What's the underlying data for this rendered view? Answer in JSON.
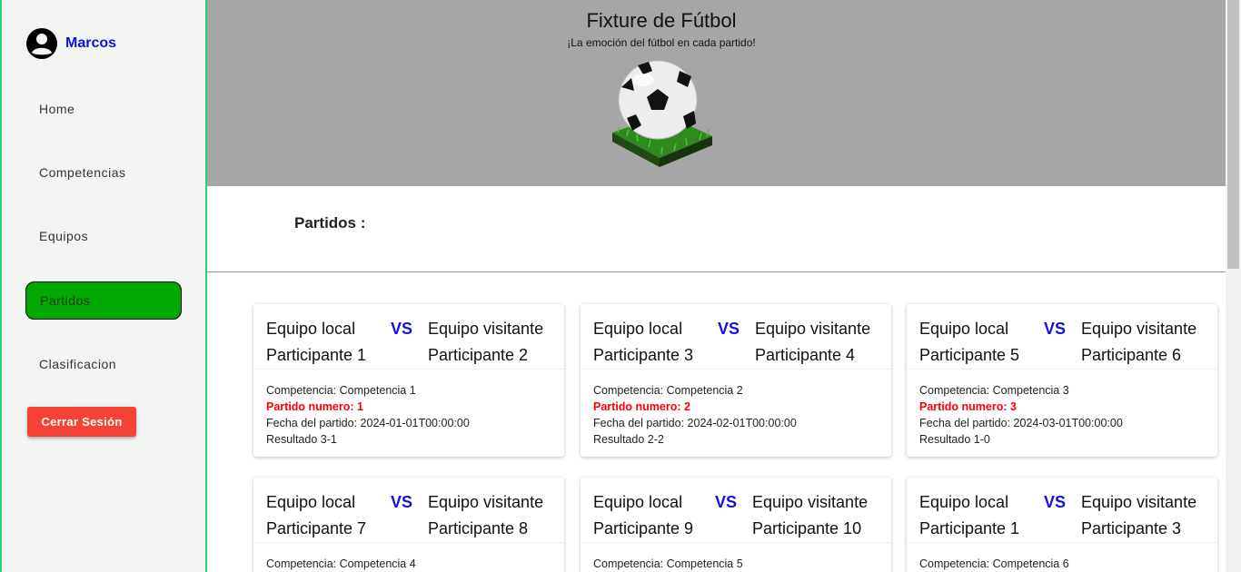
{
  "user": {
    "name": "Marcos",
    "icon": "account-circle-icon"
  },
  "nav": [
    {
      "label": "Home",
      "active": false
    },
    {
      "label": "Competencias",
      "active": false
    },
    {
      "label": "Equipos",
      "active": false
    },
    {
      "label": "Partidos",
      "active": true
    },
    {
      "label": "Clasificacion",
      "active": false
    }
  ],
  "logout_label": "Cerrar Sesión",
  "header": {
    "title": "Fixture de Fútbol",
    "subtitle": "¡La emoción del fútbol en cada partido!",
    "image": "soccer-ball-on-grass"
  },
  "section_title": "Partidos :",
  "labels": {
    "local": "Equipo local",
    "visitor": "Equipo visitante",
    "vs": "VS"
  },
  "matches": [
    {
      "local": "Participante 1",
      "visitor": "Participante 2",
      "competition": "Competencia: Competencia 1",
      "number": "Partido numero: 1",
      "date": "Fecha del partido: 2024-01-01T00:00:00",
      "result": "Resultado 3-1"
    },
    {
      "local": "Participante 3",
      "visitor": "Participante 4",
      "competition": "Competencia: Competencia 2",
      "number": "Partido numero: 2",
      "date": "Fecha del partido: 2024-02-01T00:00:00",
      "result": "Resultado 2-2"
    },
    {
      "local": "Participante 5",
      "visitor": "Participante 6",
      "competition": "Competencia: Competencia 3",
      "number": "Partido numero: 3",
      "date": "Fecha del partido: 2024-03-01T00:00:00",
      "result": "Resultado 1-0"
    },
    {
      "local": "Participante 7",
      "visitor": "Participante 8",
      "competition": "Competencia: Competencia 4"
    },
    {
      "local": "Participante 9",
      "visitor": "Participante 10",
      "competition": "Competencia: Competencia 5"
    },
    {
      "local": "Participante 1",
      "visitor": "Participante 3",
      "competition": "Competencia: Competencia 6"
    }
  ],
  "colors": {
    "accent_blue": "#1010e0",
    "active_green": "#00a800",
    "logout_red": "#f44336",
    "header_gray": "#a6a6a6",
    "match_number_red": "#ff0000"
  }
}
